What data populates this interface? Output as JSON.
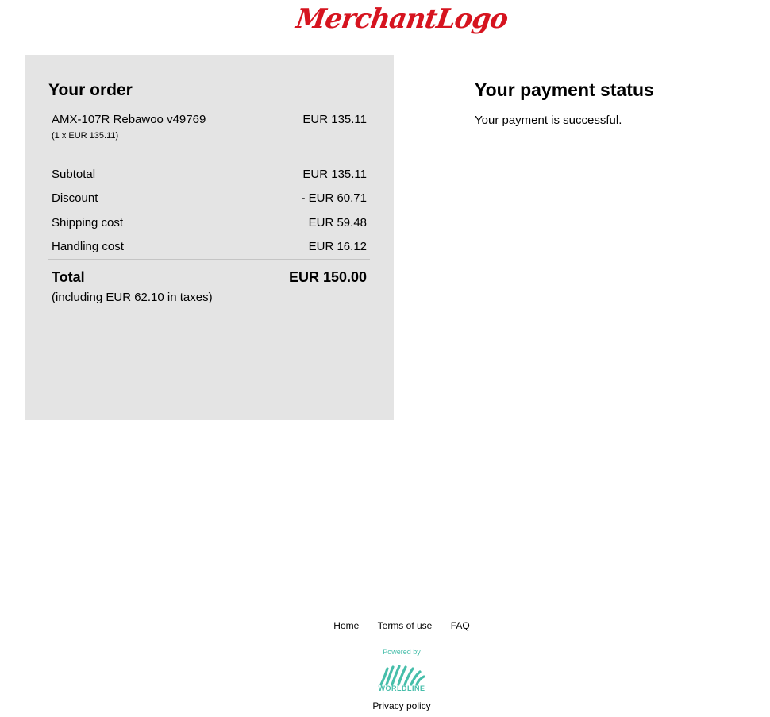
{
  "header": {
    "logo_text": "MerchantLogo"
  },
  "order": {
    "title": "Your order",
    "item": {
      "name": "AMX-107R Rebawoo v49769",
      "price": "EUR 135.11",
      "qty_detail": "(1 x EUR 135.11)"
    },
    "subtotal_label": "Subtotal",
    "subtotal_value": "EUR 135.11",
    "discount_label": "Discount",
    "discount_value": "- EUR 60.71",
    "shipping_label": "Shipping cost",
    "shipping_value": "EUR 59.48",
    "handling_label": "Handling cost",
    "handling_value": "EUR 16.12",
    "total_label": "Total",
    "total_value": "EUR 150.00",
    "tax_note": "(including EUR 62.10 in taxes)"
  },
  "status": {
    "title": "Your payment status",
    "message": "Your payment is successful."
  },
  "footer": {
    "links": [
      "Home",
      "Terms of use",
      "FAQ"
    ],
    "powered_by": "Powered by",
    "brand": "WORLDLINE",
    "privacy": "Privacy policy"
  },
  "colors": {
    "logo": "#d6141f",
    "panel_bg": "#e4e4e4",
    "brand_teal": "#46beaa"
  }
}
